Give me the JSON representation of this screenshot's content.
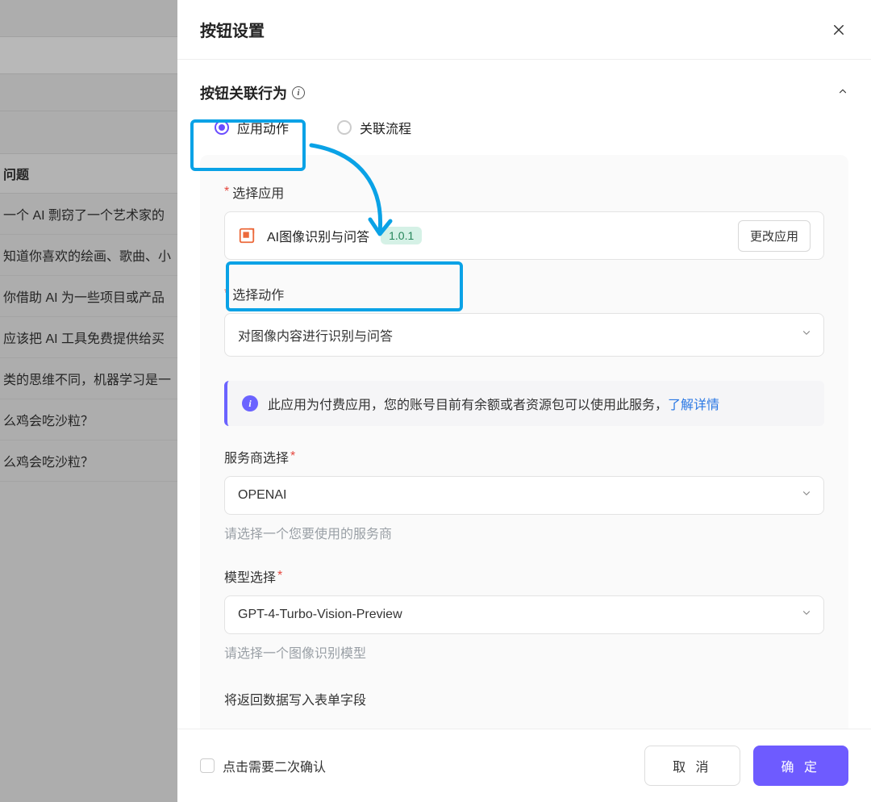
{
  "background": {
    "header": "问题",
    "items": [
      "一个 AI 剽窃了一个艺术家的",
      "知道你喜欢的绘画、歌曲、小",
      "你借助 AI 为一些项目或产品",
      "应该把 AI 工具免费提供给买",
      "类的思维不同，机器学习是一",
      "么鸡会吃沙粒？",
      "么鸡会吃沙粒？"
    ]
  },
  "panel": {
    "title": "按钮设置",
    "section": {
      "title": "按钮关联行为",
      "radio_app": "应用动作",
      "radio_flow": "关联流程"
    },
    "app_field": {
      "label": "选择应用",
      "name": "AI图像识别与问答",
      "version": "1.0.1",
      "change": "更改应用"
    },
    "action_field": {
      "label": "选择动作",
      "value": "对图像内容进行识别与问答"
    },
    "notice": {
      "text": "此应用为付费应用，您的账号目前有余额或者资源包可以使用此服务，",
      "link": "了解详情"
    },
    "provider": {
      "label": "服务商选择",
      "value": "OPENAI",
      "helper": "请选择一个您要使用的服务商"
    },
    "model": {
      "label": "模型选择",
      "value": "GPT-4-Turbo-Vision-Preview",
      "helper": "请选择一个图像识别模型"
    },
    "cutoff": "将返回数据写入表单字段",
    "footer": {
      "confirm_label": "点击需要二次确认",
      "cancel": "取 消",
      "ok": "确 定"
    }
  }
}
